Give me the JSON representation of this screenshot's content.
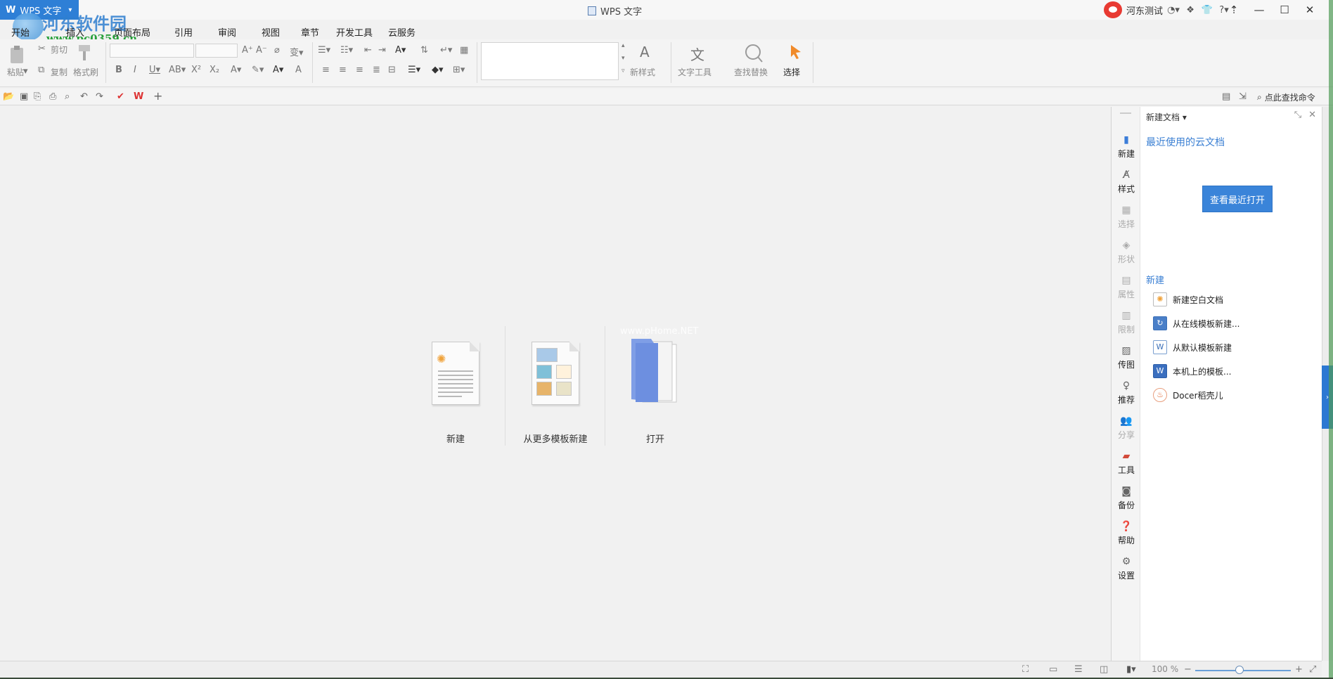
{
  "title_bar": {
    "app_menu_label": "WPS 文字",
    "window_title": "WPS 文字",
    "user_name": "河东测试"
  },
  "watermark": {
    "site_name": "河东软件园",
    "site_url": "www.pc0359.cn",
    "center_mark": "www.pHome.NET"
  },
  "tabs": [
    "开始",
    "插入",
    "页面布局",
    "引用",
    "审阅",
    "视图",
    "章节",
    "开发工具",
    "云服务"
  ],
  "ribbon": {
    "paste": "粘贴",
    "cut": "剪切",
    "copy": "复制",
    "format_painter": "格式刷",
    "new_style": "新样式",
    "text_tools": "文字工具",
    "find_replace": "查找替换",
    "select": "选择"
  },
  "quick_access": {
    "command_search": "点此查找命令"
  },
  "start_page": {
    "items": [
      {
        "label": "新建"
      },
      {
        "label": "从更多模板新建"
      },
      {
        "label": "打开"
      }
    ]
  },
  "sidebar": {
    "items": [
      {
        "label": "新建",
        "icon": "file-icon",
        "state": "on"
      },
      {
        "label": "样式",
        "icon": "style-icon",
        "state": "mid"
      },
      {
        "label": "选择",
        "icon": "select-icon",
        "state": "off"
      },
      {
        "label": "形状",
        "icon": "shape-icon",
        "state": "off"
      },
      {
        "label": "属性",
        "icon": "properties-icon",
        "state": "off"
      },
      {
        "label": "限制",
        "icon": "restrict-icon",
        "state": "off"
      },
      {
        "label": "传图",
        "icon": "image-upload-icon",
        "state": "mid"
      },
      {
        "label": "推荐",
        "icon": "recommend-icon",
        "state": "mid"
      },
      {
        "label": "分享",
        "icon": "share-icon",
        "state": "off"
      },
      {
        "label": "工具",
        "icon": "toolbox-icon",
        "state": "mid"
      },
      {
        "label": "备份",
        "icon": "backup-icon",
        "state": "mid"
      },
      {
        "label": "帮助",
        "icon": "help-icon",
        "state": "mid"
      },
      {
        "label": "设置",
        "icon": "settings-icon",
        "state": "mid"
      }
    ]
  },
  "task_pane": {
    "header": "新建文档",
    "cloud_section": "最近使用的云文档",
    "recent_button": "查看最近打开",
    "new_section": "新建",
    "new_items": [
      {
        "label": "新建空白文档"
      },
      {
        "label": "从在线模板新建..."
      },
      {
        "label": "从默认模板新建"
      },
      {
        "label": "本机上的模板..."
      },
      {
        "label": "Docer稻壳儿"
      }
    ]
  },
  "status_bar": {
    "zoom": "100 %",
    "zoom_fraction": 0.46
  },
  "colors": {
    "accent": "#3a84d9",
    "app_menu_bg": "#2e7fd6"
  }
}
